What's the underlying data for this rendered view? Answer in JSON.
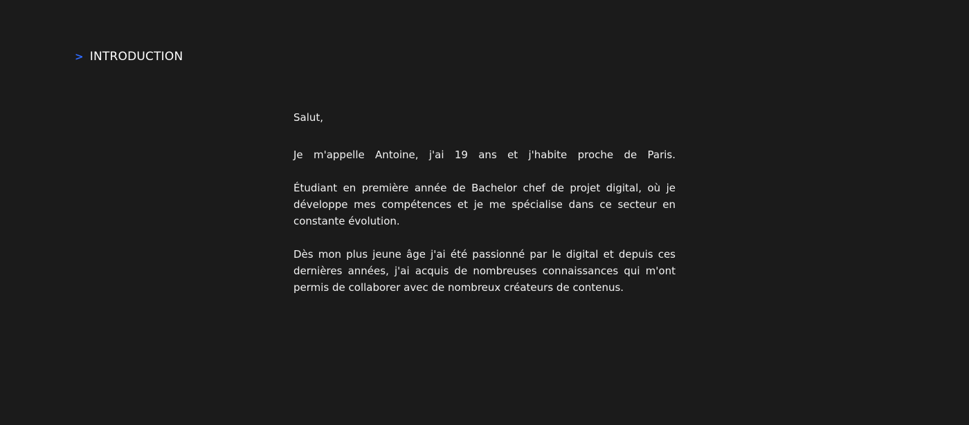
{
  "section": {
    "marker": ">",
    "title": "INTRODUCTION"
  },
  "intro": {
    "greeting": "Salut,",
    "p1": "Je m'appelle Antoine, j'ai 19 ans et j'habite proche de Paris.",
    "p2": "Étudiant en première année de Bachelor chef de projet digital, où je développe mes compétences et je me spécialise dans ce secteur en constante évolution.",
    "p3": "Dès mon plus jeune âge j'ai été passionné par le digital et depuis ces dernières années, j'ai acquis de nombreuses connaissances qui m'ont permis de collaborer avec de nombreux créateurs de contenus."
  },
  "colors": {
    "background": "#1b1b1b",
    "text": "#f2f2f2",
    "accent": "#2f6bff"
  }
}
